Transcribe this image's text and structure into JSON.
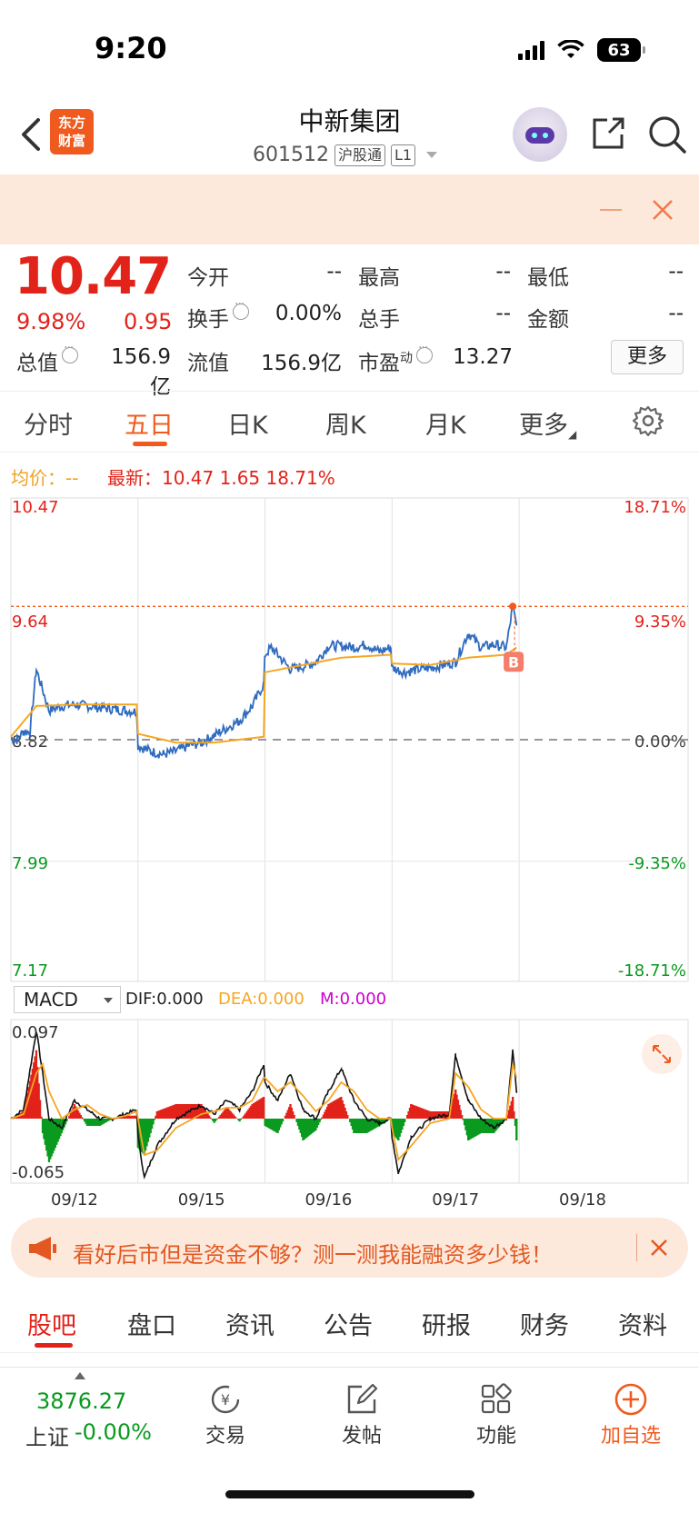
{
  "status": {
    "time": "9:20",
    "battery": "63"
  },
  "header": {
    "logo": "东方财富",
    "logo_line1": "东方",
    "logo_line2": "财富",
    "name": "中新集团",
    "code": "601512",
    "tag1": "沪股通",
    "tag2": "L1"
  },
  "quote": {
    "price": "10.47",
    "pct": "9.98%",
    "change": "0.95",
    "fields": {
      "open_label": "今开",
      "open": "--",
      "high_label": "最高",
      "high": "--",
      "low_label": "最低",
      "low": "--",
      "turnover_label": "换手",
      "turnover": "0.00%",
      "volume_label": "总手",
      "volume": "--",
      "amount_label": "金额",
      "amount": "--",
      "mcap_label": "总值",
      "mcap": "156.9亿",
      "float_label": "流值",
      "float": "156.9亿",
      "pe_label": "市盈",
      "pe_sup": "动",
      "pe": "13.27"
    },
    "more": "更多"
  },
  "tabs": [
    "分时",
    "五日",
    "日K",
    "周K",
    "月K",
    "更多"
  ],
  "legend": {
    "avg": "均价：--",
    "latest": "最新：10.47  1.65  18.71%"
  },
  "colors": {
    "up": "#e2231a",
    "down": "#0a9a1f",
    "accent": "#f05a1e",
    "price_line": "#2f6bbf",
    "avg_line": "#f5a623"
  },
  "chart_data": {
    "type": "line",
    "title": "",
    "days": [
      "09/12",
      "09/15",
      "09/16",
      "09/17",
      "09/18"
    ],
    "y_left_ticks": [
      "10.47",
      "9.64",
      "8.82",
      "7.99",
      "7.17"
    ],
    "y_right_ticks": [
      "18.71%",
      "9.35%",
      "0.00%",
      "-9.35%",
      "-18.71%"
    ],
    "ylim": [
      7.17,
      10.47
    ],
    "prev_close": 8.82,
    "limit_line": 9.73,
    "signal_marker": "B",
    "series": [
      {
        "role": "price",
        "x": [
          0,
          0.05,
          0.1,
          0.15,
          0.2,
          0.3,
          0.4,
          0.5,
          0.6,
          0.7,
          0.8,
          0.9,
          0.99,
          1.0,
          1.1,
          1.2,
          1.3,
          1.4,
          1.5,
          1.6,
          1.7,
          1.8,
          1.9,
          1.99,
          2.0,
          2.05,
          2.1,
          2.2,
          2.3,
          2.4,
          2.5,
          2.6,
          2.7,
          2.8,
          2.9,
          2.99,
          3.0,
          3.1,
          3.2,
          3.3,
          3.4,
          3.5,
          3.6,
          3.7,
          3.8,
          3.9,
          3.95,
          3.98
        ],
        "values": [
          8.83,
          8.82,
          8.88,
          8.87,
          9.3,
          9.02,
          9.05,
          9.06,
          9.05,
          9.04,
          9.03,
          9.02,
          9.01,
          8.78,
          8.74,
          8.72,
          8.74,
          8.78,
          8.8,
          8.85,
          8.9,
          8.95,
          9.05,
          9.2,
          9.4,
          9.45,
          9.4,
          9.3,
          9.32,
          9.35,
          9.46,
          9.46,
          9.45,
          9.47,
          9.42,
          9.45,
          9.31,
          9.28,
          9.3,
          9.31,
          9.33,
          9.35,
          9.55,
          9.45,
          9.47,
          9.45,
          9.73,
          9.6
        ]
      },
      {
        "role": "avg",
        "x": [
          0,
          0.2,
          0.5,
          0.99,
          1.0,
          1.3,
          1.6,
          1.99,
          2.0,
          2.3,
          2.6,
          2.99,
          3.0,
          3.3,
          3.6,
          3.9,
          3.98
        ],
        "values": [
          8.84,
          9.05,
          9.06,
          9.06,
          8.86,
          8.8,
          8.8,
          8.84,
          9.28,
          9.33,
          9.38,
          9.4,
          9.34,
          9.33,
          9.38,
          9.4,
          9.45
        ]
      }
    ],
    "macd": {
      "label": "MACD",
      "dif": "DIF:0.000",
      "dea": "DEA:0.000",
      "m": "M:0.000",
      "ylim": [
        -0.065,
        0.097
      ],
      "top_label": "0.097",
      "bottom_label": "-0.065",
      "x": [
        0,
        0.1,
        0.2,
        0.25,
        0.3,
        0.4,
        0.5,
        0.6,
        0.7,
        0.8,
        0.9,
        0.99,
        1.0,
        1.05,
        1.15,
        1.3,
        1.5,
        1.6,
        1.7,
        1.8,
        1.9,
        1.99,
        2.0,
        2.1,
        2.2,
        2.3,
        2.4,
        2.5,
        2.6,
        2.7,
        2.8,
        2.9,
        2.99,
        3.0,
        3.05,
        3.15,
        3.3,
        3.45,
        3.5,
        3.6,
        3.7,
        3.8,
        3.9,
        3.95,
        3.98
      ],
      "dif_values": [
        0,
        0.01,
        0.097,
        0.05,
        0.0,
        -0.01,
        0.02,
        0.01,
        0.0,
        0.0,
        0.005,
        0.01,
        -0.02,
        -0.065,
        -0.03,
        0.0,
        0.015,
        0.005,
        0.02,
        0.01,
        0.03,
        0.06,
        0.04,
        0.02,
        0.05,
        0.01,
        0.0,
        0.03,
        0.055,
        0.02,
        0.0,
        -0.005,
        0.0,
        -0.02,
        -0.06,
        -0.02,
        0.0,
        0.005,
        0.07,
        0.02,
        0.0,
        -0.01,
        0.0,
        0.075,
        0.03
      ],
      "dea_values": [
        0,
        0.005,
        0.05,
        0.06,
        0.03,
        0.0,
        0.01,
        0.015,
        0.005,
        0.0,
        0.003,
        0.008,
        0.0,
        -0.04,
        -0.035,
        -0.01,
        0.005,
        0.008,
        0.012,
        0.012,
        0.02,
        0.045,
        0.045,
        0.03,
        0.04,
        0.025,
        0.008,
        0.02,
        0.04,
        0.03,
        0.01,
        0.0,
        0.0,
        -0.01,
        -0.045,
        -0.03,
        -0.005,
        0.0,
        0.05,
        0.035,
        0.01,
        0.0,
        0.0,
        0.06,
        0.045
      ]
    }
  },
  "promo": {
    "text": "看好后市但是资金不够？测一测我能融资多少钱！"
  },
  "bottom_tabs": [
    "股吧",
    "盘口",
    "资讯",
    "公告",
    "研报",
    "财务",
    "资料"
  ],
  "bottom_nav": {
    "index_value": "3876.27",
    "index_name": "上证",
    "index_change": "-0.00%",
    "items": [
      "交易",
      "发帖",
      "功能",
      "加自选"
    ]
  }
}
